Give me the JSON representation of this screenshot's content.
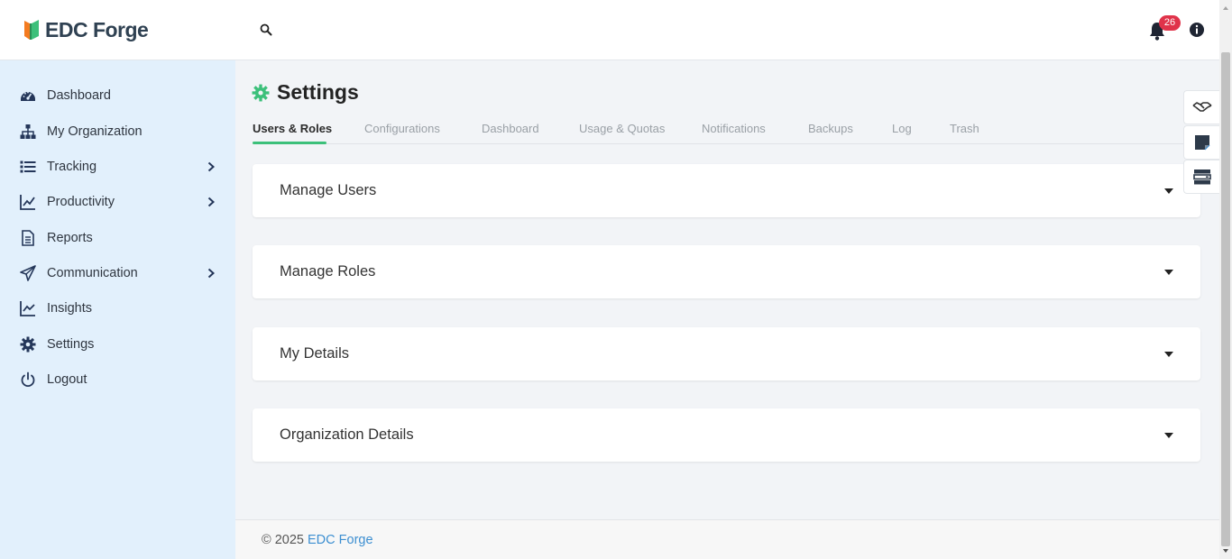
{
  "header": {
    "logo_text": "EDC Forge",
    "notifications_count": "26"
  },
  "sidebar": {
    "items": [
      {
        "label": "Dashboard",
        "icon": "dashboard-gauge-icon",
        "has_submenu": false
      },
      {
        "label": "My Organization",
        "icon": "org-chart-icon",
        "has_submenu": false
      },
      {
        "label": "Tracking",
        "icon": "list-icon",
        "has_submenu": true
      },
      {
        "label": "Productivity",
        "icon": "line-chart-icon",
        "has_submenu": true
      },
      {
        "label": "Reports",
        "icon": "document-icon",
        "has_submenu": false
      },
      {
        "label": "Communication",
        "icon": "paper-plane-icon",
        "has_submenu": true
      },
      {
        "label": "Insights",
        "icon": "trend-chart-icon",
        "has_submenu": false
      },
      {
        "label": "Settings",
        "icon": "gear-icon",
        "has_submenu": false
      },
      {
        "label": "Logout",
        "icon": "power-icon",
        "has_submenu": false
      }
    ]
  },
  "main": {
    "title": "Settings",
    "tabs": [
      {
        "label": "Users & Roles",
        "active": true
      },
      {
        "label": "Configurations",
        "active": false
      },
      {
        "label": "Dashboard",
        "active": false
      },
      {
        "label": "Usage & Quotas",
        "active": false
      },
      {
        "label": "Notifications",
        "active": false
      },
      {
        "label": "Backups",
        "active": false
      },
      {
        "label": "Log",
        "active": false
      },
      {
        "label": "Trash",
        "active": false
      }
    ],
    "panels": [
      {
        "title": "Manage Users"
      },
      {
        "title": "Manage Roles"
      },
      {
        "title": "My Details"
      },
      {
        "title": "Organization Details"
      }
    ]
  },
  "footer": {
    "copyright": "© 2025 ",
    "link_text": "EDC Forge"
  },
  "colors": {
    "accent_green": "#3cc07a",
    "sidebar_bg": "#e2f0fc",
    "badge_red": "#e0334a",
    "link_blue": "#3d8fd1",
    "icon_navy": "#25375a"
  }
}
